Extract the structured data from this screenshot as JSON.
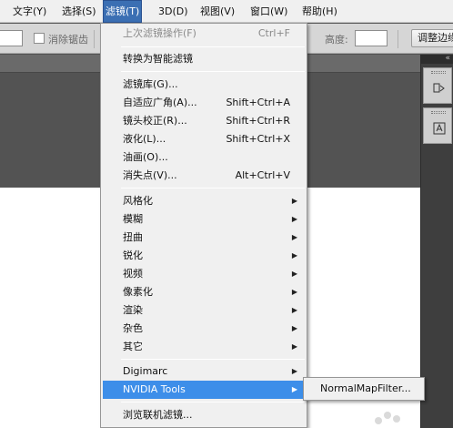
{
  "menubar": {
    "items": [
      {
        "label": "文字(Y)"
      },
      {
        "label": "选择(S)"
      },
      {
        "label": "滤镜(T)"
      },
      {
        "label": "3D(D)"
      },
      {
        "label": "视图(V)"
      },
      {
        "label": "窗口(W)"
      },
      {
        "label": "帮助(H)"
      }
    ]
  },
  "options_bar": {
    "antialias_label": "消除锯齿",
    "height_label": "高度:",
    "adjust_button": "调整边缘"
  },
  "filter_menu": {
    "last_filter": {
      "label": "上次滤镜操作(F)",
      "shortcut": "Ctrl+F"
    },
    "convert_smart": {
      "label": "转换为智能滤镜"
    },
    "gallery": {
      "label": "滤镜库(G)..."
    },
    "adaptive_wide": {
      "label": "自适应广角(A)...",
      "shortcut": "Shift+Ctrl+A"
    },
    "lens_correction": {
      "label": "镜头校正(R)...",
      "shortcut": "Shift+Ctrl+R"
    },
    "liquify": {
      "label": "液化(L)...",
      "shortcut": "Shift+Ctrl+X"
    },
    "oil_paint": {
      "label": "油画(O)..."
    },
    "vanishing_point": {
      "label": "消失点(V)...",
      "shortcut": "Alt+Ctrl+V"
    },
    "submenus": [
      {
        "label": "风格化"
      },
      {
        "label": "模糊"
      },
      {
        "label": "扭曲"
      },
      {
        "label": "锐化"
      },
      {
        "label": "视频"
      },
      {
        "label": "像素化"
      },
      {
        "label": "渲染"
      },
      {
        "label": "杂色"
      },
      {
        "label": "其它"
      }
    ],
    "digimarc": {
      "label": "Digimarc"
    },
    "nvidia": {
      "label": "NVIDIA Tools"
    },
    "browse_online": {
      "label": "浏览联机滤镜..."
    }
  },
  "nvidia_submenu": {
    "items": [
      {
        "label": "NormalMapFilter..."
      }
    ]
  },
  "colors": {
    "highlight": "#3d8ee9",
    "menubar_active": "#3b6fb3",
    "workspace": "#535353"
  }
}
